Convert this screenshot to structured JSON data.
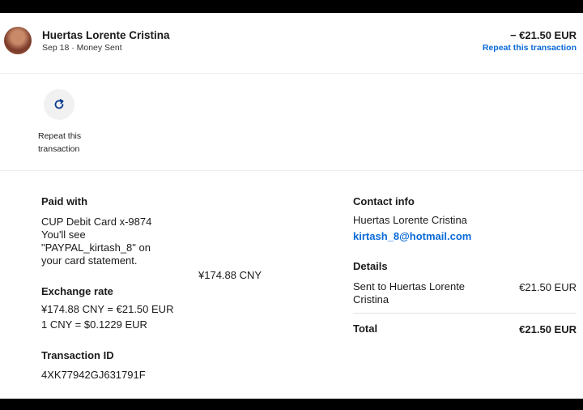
{
  "header": {
    "name": "Huertas Lorente Cristina",
    "date": "Sep 18",
    "separator": "·",
    "type": "Money Sent",
    "amount": "− €21.50 EUR",
    "repeat_link": "Repeat this transaction"
  },
  "repeat_action": {
    "icon": "refresh-icon",
    "label_line1": "Repeat this",
    "label_line2": "transaction"
  },
  "paid_with": {
    "heading": "Paid with",
    "card": "CUP Debit Card x-9874",
    "note_line1": "You'll see",
    "note_line2": "\"PAYPAL_kirtash_8\" on",
    "note_line3": "your card statement.",
    "charged_amount": "¥174.88 CNY"
  },
  "exchange_rate": {
    "heading": "Exchange rate",
    "line1": "¥174.88 CNY = €21.50 EUR",
    "line2": "1 CNY = $0.1229 EUR"
  },
  "transaction": {
    "heading": "Transaction ID",
    "id": "4XK77942GJ631791F"
  },
  "contact": {
    "heading": "Contact info",
    "name": "Huertas Lorente Cristina",
    "email": "kirtash_8@hotmail.com"
  },
  "details": {
    "heading": "Details",
    "sent_to_line1": "Sent to Huertas Lorente",
    "sent_to_line2": "Cristina",
    "sent_amount": "€21.50 EUR",
    "total_label": "Total",
    "total_amount": "€21.50 EUR"
  },
  "colors": {
    "link": "#0a6ad8",
    "text": "#1a1a1a",
    "background": "#ffffff",
    "frame": "#000000"
  }
}
